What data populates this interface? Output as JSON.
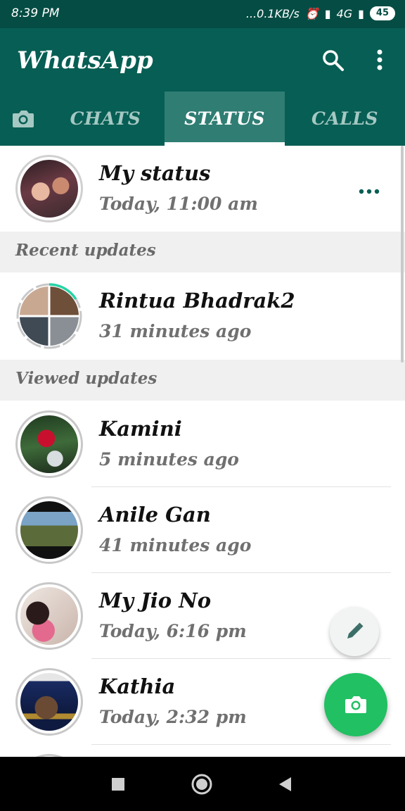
{
  "status_bar": {
    "time": "8:39 PM",
    "network_speed": "...0.1KB/s",
    "network_type": "4G",
    "battery": "45"
  },
  "header": {
    "title": "WhatsApp",
    "icons": [
      "search-icon",
      "more-vert-icon"
    ]
  },
  "tabs": [
    {
      "label": "CHATS",
      "active": false
    },
    {
      "label": "STATUS",
      "active": true
    },
    {
      "label": "CALLS",
      "active": false
    }
  ],
  "my_status": {
    "name": "My status",
    "time": "Today, 11:00 am"
  },
  "sections": {
    "recent": "Recent updates",
    "viewed": "Viewed updates"
  },
  "recent_updates": [
    {
      "name": "Rintua Bhadrak2",
      "time": "31 minutes ago"
    }
  ],
  "viewed_updates": [
    {
      "name": "Kamini",
      "time": "5 minutes ago"
    },
    {
      "name": "Anile Gan",
      "time": "41 minutes ago"
    },
    {
      "name": "My Jio No",
      "time": "Today, 6:16 pm"
    },
    {
      "name": "Kathia",
      "time": "Today, 2:32 pm"
    }
  ],
  "colors": {
    "primary": "#075e54",
    "status_bar": "#054d44",
    "accent": "#21c063",
    "unread_ring": "#25d3a6",
    "viewed_ring": "#c8c8c8"
  }
}
